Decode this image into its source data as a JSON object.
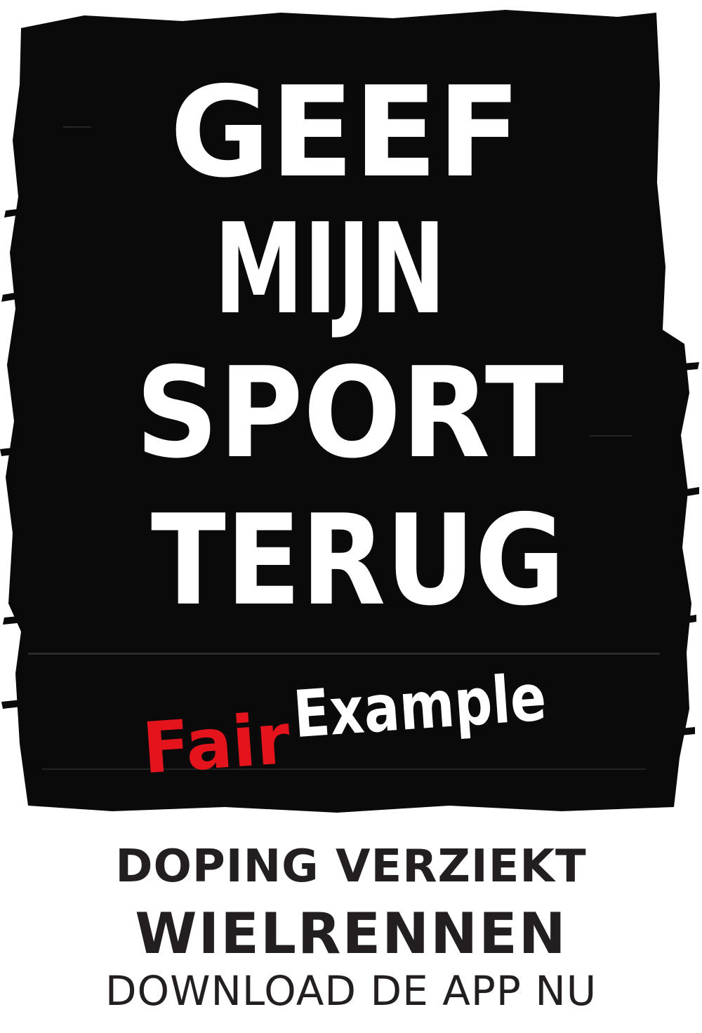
{
  "headline": {
    "lines": [
      "GEEF",
      "MIJN",
      "SPORT",
      "TERUG"
    ]
  },
  "brand": {
    "part1": "Fair",
    "part2": "Example"
  },
  "footer": {
    "line1": "DOPING VERZIEKT",
    "line2": "WIELRENNEN",
    "line3": "DOWNLOAD DE APP NU"
  },
  "colors": {
    "background": "#ffffff",
    "brush": "#0a0a0a",
    "headline_text": "#ffffff",
    "accent_red": "#e3141c",
    "footer_text": "#231f20"
  }
}
